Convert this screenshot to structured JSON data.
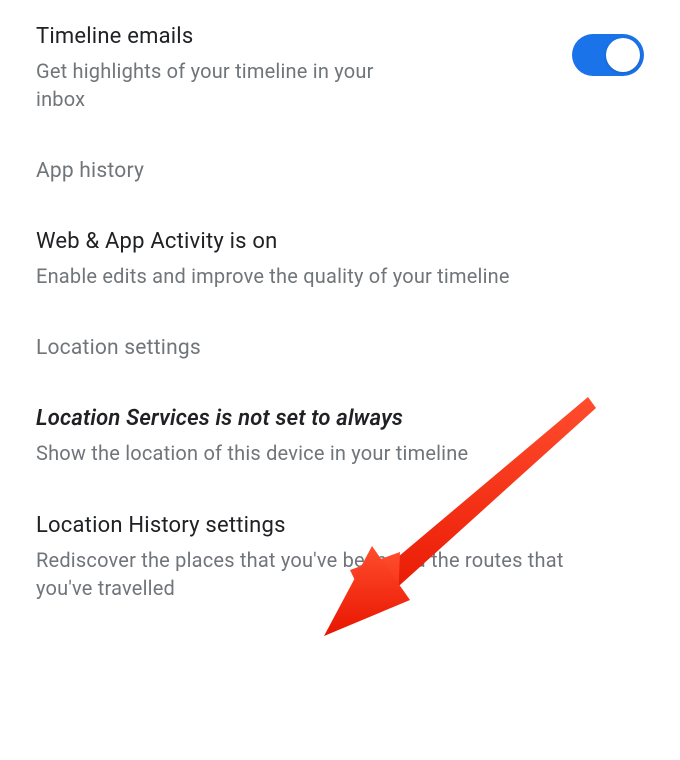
{
  "timelineEmails": {
    "title": "Timeline emails",
    "subtitle": "Get highlights of your timeline in your inbox",
    "enabled": true
  },
  "sections": {
    "appHistory": "App history",
    "locationSettings": "Location settings"
  },
  "webAppActivity": {
    "title": "Web & App Activity is on",
    "subtitle": "Enable edits and improve the quality of your timeline"
  },
  "locationServices": {
    "title": "Location Services is not set to always",
    "subtitle": "Show the location of this device in your timeline"
  },
  "locationHistory": {
    "title": "Location History settings",
    "subtitle": "Rediscover the places that you've been and the routes that you've travelled"
  },
  "colors": {
    "toggleOn": "#1a73e8",
    "arrow": "#ff2a1a"
  }
}
